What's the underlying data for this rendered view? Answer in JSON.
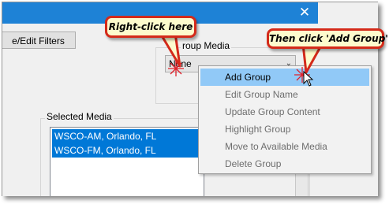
{
  "window": {
    "close_glyph": "✕"
  },
  "filters": {
    "button_label": "e/Edit Filters"
  },
  "group_media": {
    "label": "roup Media",
    "selected_value": "None",
    "arrow_glyph": "⌄"
  },
  "selected_media": {
    "label": "Selected Media",
    "items": [
      "WSCO-AM, Orlando, FL",
      "WSCO-FM, Orlando, FL"
    ]
  },
  "context_menu": {
    "items": [
      {
        "label": "Add Group",
        "enabled": true,
        "highlighted": true
      },
      {
        "label": "Edit Group Name",
        "enabled": false,
        "highlighted": false
      },
      {
        "label": "Update Group Content",
        "enabled": false,
        "highlighted": false
      },
      {
        "label": "Highlight Group",
        "enabled": false,
        "highlighted": false
      },
      {
        "label": "Move to Available Media",
        "enabled": false,
        "highlighted": false
      },
      {
        "label": "Delete Group",
        "enabled": false,
        "highlighted": false
      }
    ]
  },
  "callouts": {
    "first": "Right-click here",
    "second": "Then click 'Add Group'"
  },
  "colors": {
    "titlebar": "#1e82d6",
    "selection": "#0078d7",
    "menu_highlight": "#91c9f7",
    "callout_border": "#d42a1a",
    "callout_fill": "#fdfbcd"
  }
}
